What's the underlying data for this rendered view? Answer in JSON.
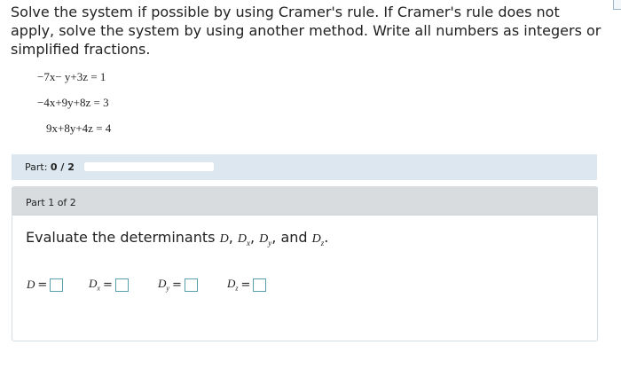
{
  "prompt": "Solve the system if possible by using Cramer's rule. If Cramer's rule does not apply, solve the system by using another method. Write all numbers as integers or simplified fractions.",
  "equations": [
    {
      "lhs": "−7x− y+3z",
      "rhs": "1"
    },
    {
      "lhs": "−4x+9y+8z",
      "rhs": "3"
    },
    {
      "lhs": "9x+8y+4z",
      "rhs": "4"
    }
  ],
  "part_bar": {
    "label": "Part:",
    "value": "0 / 2",
    "progress_fraction": 0.0
  },
  "panel": {
    "header": "Part 1 of 2",
    "question_text": "Evaluate the determinants",
    "question_and": "and",
    "answers": [
      {
        "symbol": "D",
        "sub": ""
      },
      {
        "symbol": "D",
        "sub": "x"
      },
      {
        "symbol": "D",
        "sub": "y"
      },
      {
        "symbol": "D",
        "sub": "z"
      }
    ]
  },
  "colors": {
    "part_bar_bg": "#dde7ef",
    "panel_header_bg": "#d9dcdf",
    "answer_box_border": "#5a9fb0"
  }
}
